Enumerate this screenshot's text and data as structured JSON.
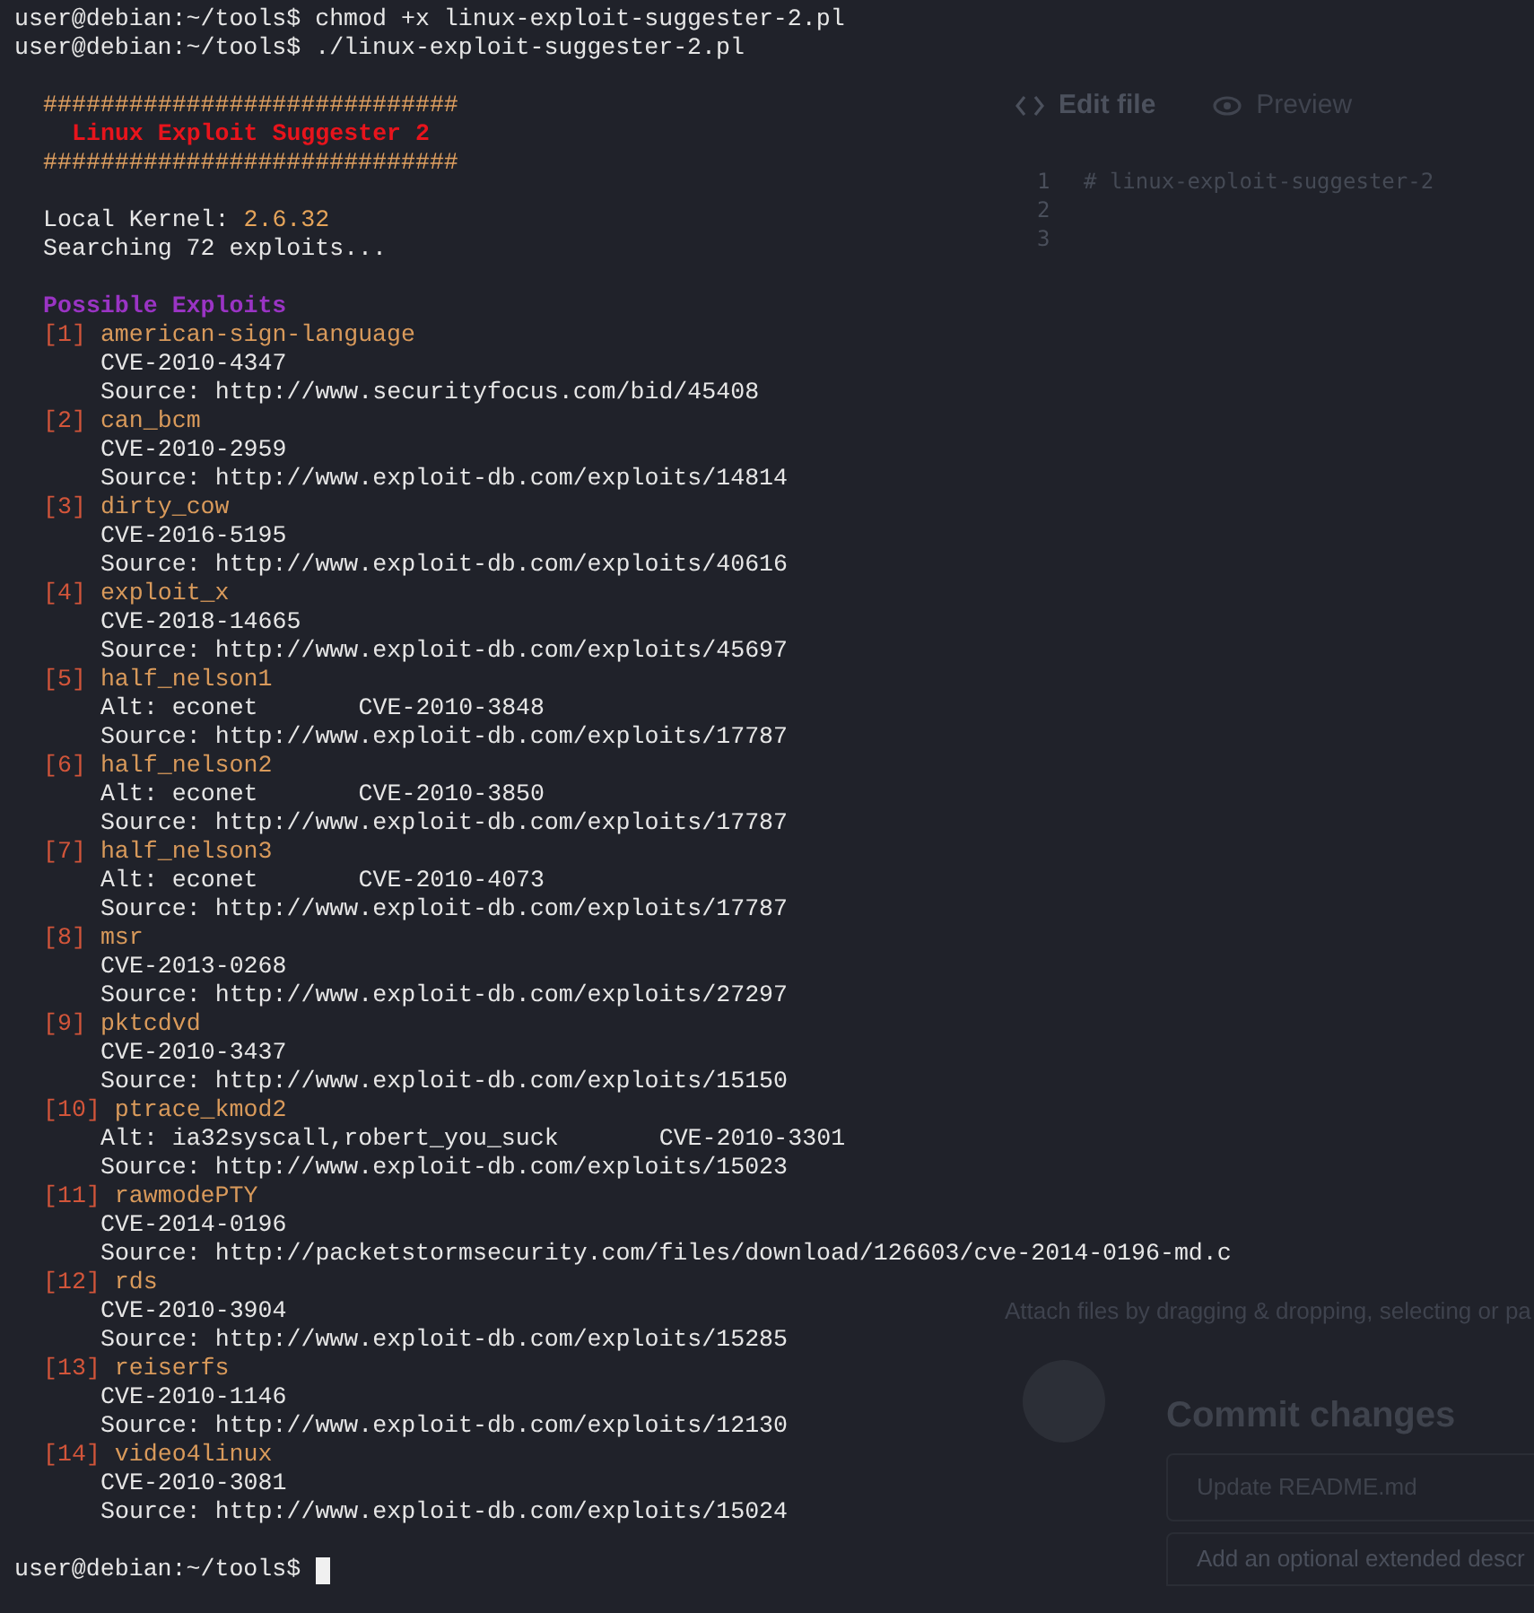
{
  "background_page": {
    "tabs": [
      {
        "label": "Edit file",
        "selected": true
      },
      {
        "label": "Preview",
        "selected": false
      }
    ],
    "editor_lines": [
      {
        "number": "1",
        "text": "# linux-exploit-suggester-2"
      },
      {
        "number": "2"
      },
      {
        "number": "3"
      }
    ],
    "attach_hint": "Attach files by dragging & dropping, selecting or pa",
    "commit": {
      "title": "Commit changes",
      "summary_placeholder": "Update README.md",
      "description_placeholder": "Add an optional extended descr"
    }
  },
  "terminal": {
    "commands": [
      {
        "prompt": "user@debian:~/tools$",
        "command": "chmod +x linux-exploit-suggester-2.pl"
      },
      {
        "prompt": "user@debian:~/tools$",
        "command": "./linux-exploit-suggester-2.pl"
      }
    ],
    "banner": {
      "rule_top": "#############################",
      "title": "Linux Exploit Suggester 2",
      "rule_bottom": "#############################"
    },
    "kernel": {
      "label": "Local Kernel:",
      "value": "2.6.32"
    },
    "searching": "Searching 72 exploits...",
    "heading": "Possible Exploits",
    "exploits": [
      {
        "index": "[1]",
        "name": "american-sign-language",
        "lines": [
          {
            "kind": "cve",
            "text": "CVE-2010-4347"
          },
          {
            "kind": "source",
            "text": "Source: http://www.securityfocus.com/bid/45408"
          }
        ]
      },
      {
        "index": "[2]",
        "name": "can_bcm",
        "lines": [
          {
            "kind": "cve",
            "text": "CVE-2010-2959"
          },
          {
            "kind": "source",
            "text": "Source: http://www.exploit-db.com/exploits/14814"
          }
        ]
      },
      {
        "index": "[3]",
        "name": "dirty_cow",
        "lines": [
          {
            "kind": "cve",
            "text": "CVE-2016-5195"
          },
          {
            "kind": "source",
            "text": "Source: http://www.exploit-db.com/exploits/40616"
          }
        ]
      },
      {
        "index": "[4]",
        "name": "exploit_x",
        "lines": [
          {
            "kind": "cve",
            "text": "CVE-2018-14665"
          },
          {
            "kind": "source",
            "text": "Source: http://www.exploit-db.com/exploits/45697"
          }
        ]
      },
      {
        "index": "[5]",
        "name": "half_nelson1",
        "lines": [
          {
            "kind": "alt",
            "alt": "Alt: econet",
            "cve": "CVE-2010-3848"
          },
          {
            "kind": "source",
            "text": "Source: http://www.exploit-db.com/exploits/17787"
          }
        ]
      },
      {
        "index": "[6]",
        "name": "half_nelson2",
        "lines": [
          {
            "kind": "alt",
            "alt": "Alt: econet",
            "cve": "CVE-2010-3850"
          },
          {
            "kind": "source",
            "text": "Source: http://www.exploit-db.com/exploits/17787"
          }
        ]
      },
      {
        "index": "[7]",
        "name": "half_nelson3",
        "lines": [
          {
            "kind": "alt",
            "alt": "Alt: econet",
            "cve": "CVE-2010-4073"
          },
          {
            "kind": "source",
            "text": "Source: http://www.exploit-db.com/exploits/17787"
          }
        ]
      },
      {
        "index": "[8]",
        "name": "msr",
        "lines": [
          {
            "kind": "cve",
            "text": "CVE-2013-0268"
          },
          {
            "kind": "source",
            "text": "Source: http://www.exploit-db.com/exploits/27297"
          }
        ]
      },
      {
        "index": "[9]",
        "name": "pktcdvd",
        "lines": [
          {
            "kind": "cve",
            "text": "CVE-2010-3437"
          },
          {
            "kind": "source",
            "text": "Source: http://www.exploit-db.com/exploits/15150"
          }
        ]
      },
      {
        "index": "[10]",
        "name": "ptrace_kmod2",
        "lines": [
          {
            "kind": "alt",
            "alt": "Alt: ia32syscall,robert_you_suck",
            "cve": "CVE-2010-3301"
          },
          {
            "kind": "source",
            "text": "Source: http://www.exploit-db.com/exploits/15023"
          }
        ]
      },
      {
        "index": "[11]",
        "name": "rawmodePTY",
        "lines": [
          {
            "kind": "cve",
            "text": "CVE-2014-0196"
          },
          {
            "kind": "source",
            "text": "Source: http://packetstormsecurity.com/files/download/126603/cve-2014-0196-md.c"
          }
        ]
      },
      {
        "index": "[12]",
        "name": "rds",
        "lines": [
          {
            "kind": "cve",
            "text": "CVE-2010-3904"
          },
          {
            "kind": "source",
            "text": "Source: http://www.exploit-db.com/exploits/15285"
          }
        ]
      },
      {
        "index": "[13]",
        "name": "reiserfs",
        "lines": [
          {
            "kind": "cve",
            "text": "CVE-2010-1146"
          },
          {
            "kind": "source",
            "text": "Source: http://www.exploit-db.com/exploits/12130"
          }
        ]
      },
      {
        "index": "[14]",
        "name": "video4linux",
        "lines": [
          {
            "kind": "cve",
            "text": "CVE-2010-3081"
          },
          {
            "kind": "source",
            "text": "Source: http://www.exploit-db.com/exploits/15024"
          }
        ]
      }
    ],
    "final_prompt": "user@debian:~/tools$"
  }
}
